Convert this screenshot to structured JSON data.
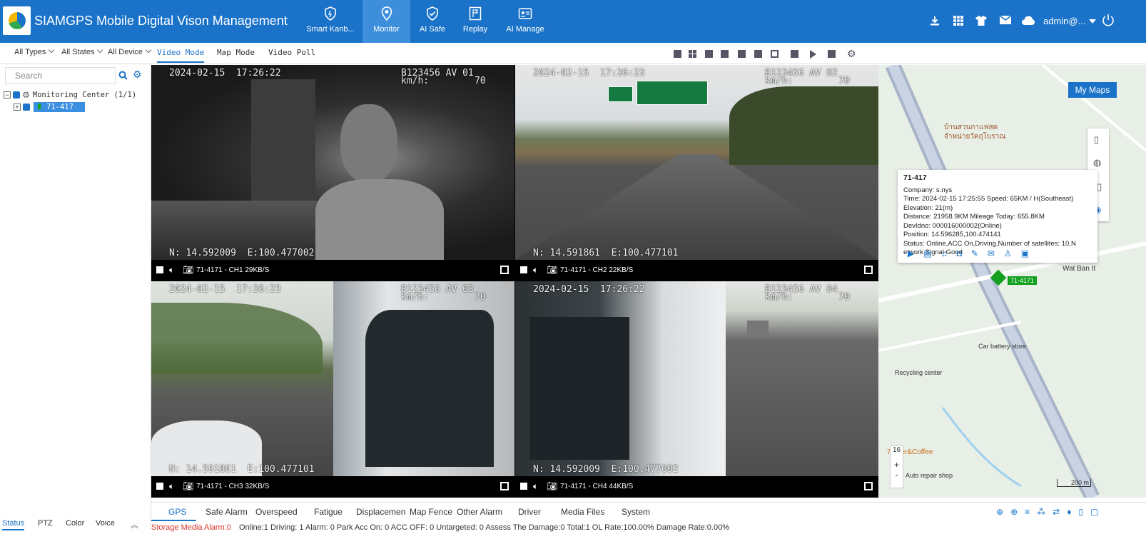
{
  "header": {
    "title": "SIAMGPS Mobile Digital Vison Management",
    "nav": [
      {
        "label": "Smart Kanb...",
        "icon": "shield-icon"
      },
      {
        "label": "Monitor",
        "icon": "location-pin-icon"
      },
      {
        "label": "AI Safe",
        "icon": "shield-check-icon"
      },
      {
        "label": "Replay",
        "icon": "flag-icon"
      },
      {
        "label": "AI Manage",
        "icon": "id-card-icon"
      }
    ],
    "user": "admin@..."
  },
  "filters": {
    "types": "All Types",
    "states": "All States",
    "device": "All Device"
  },
  "modes": [
    "Video Mode",
    "Map Mode",
    "Video Poll"
  ],
  "sidebar": {
    "search_placeholder": "Search",
    "tree_root": "Monitoring Center  (1/1)",
    "tree_vehicle": "71-417",
    "bottom_tabs": [
      "Status",
      "PTZ",
      "Color",
      "Voice"
    ]
  },
  "videos": [
    {
      "time": "2024-02-15  17:26:22",
      "plate": "B123456 AV 01",
      "speed_label": "km/h:",
      "speed": "70",
      "pos": "N: 14.592009  E:100.477002",
      "label": "71-4171 - CH1 29KB/S"
    },
    {
      "time": "2024-02-15  17:26:23",
      "plate": "B123456 AV 02",
      "speed_label": "km/h:",
      "speed": "70",
      "pos": "N: 14.591861  E:100.477101",
      "label": "71-4171 - CH2 22KB/S"
    },
    {
      "time": "2024-02-15  17:26:23",
      "plate": "B123456 AV 03",
      "speed_label": "km/h:",
      "speed": "70",
      "pos": "N: 14.591861  E:100.477101",
      "label": "71-4171 - CH3 32KB/S"
    },
    {
      "time": "2024-02-15  17:26:22",
      "plate": "B123456 AV 04",
      "speed_label": "km/h:",
      "speed": "70",
      "pos": "N: 14.592009  E:100.477002",
      "label": "71-4171 - CH4 44KB/S"
    }
  ],
  "map": {
    "my_maps": "My Maps",
    "zoom": "16",
    "scale": "200 m",
    "vehicle_tag": "71-4171",
    "labels": [
      "บ้านสวนกาแฟสด",
      "จำหน่ายวัตถุโบราณ",
      "Wat Ban It",
      "Car battery store",
      "Recycling center",
      "Auto repair shop",
      "72 ber&Coffee"
    ],
    "popup": {
      "title": "71-417",
      "company": "Company:  s.nys",
      "time": "Time:  2024-02-15 17:25:55    Speed:  65KM / H(Southeast)",
      "elevation": "Elevation:  21(m)",
      "distance": "Distance:  21958.9KM    Mileage Today:  655.8KM",
      "devid": "DevIdno:  000016000002(Online)",
      "position": "Position:  14.596285,100.474141",
      "status1": "Status:  Online,ACC On,Driving,Number of satellites:  10,N",
      "status2": "etwork Signal Good"
    }
  },
  "bottom_tabs": [
    "GPS",
    "Safe Alarm",
    "Overspeed",
    "Fatigue",
    "Displacemen",
    "Map Fence",
    "Other Alarm",
    "Driver",
    "Media Files",
    "System"
  ],
  "status_bar": {
    "storage": "Storage Media Alarm:0",
    "rest": "Online:1   Driving: 1   Alarm: 0   Park Acc On: 0   ACC OFF: 0   Untargeted: 0   Assess The Damage:0   Total:1   OL Rate:100.00%   Damage Rate:0.00%"
  },
  "colors": {
    "primary": "#1a73c8",
    "alarm": "#d9352b",
    "vehicle": "#12a01e"
  }
}
